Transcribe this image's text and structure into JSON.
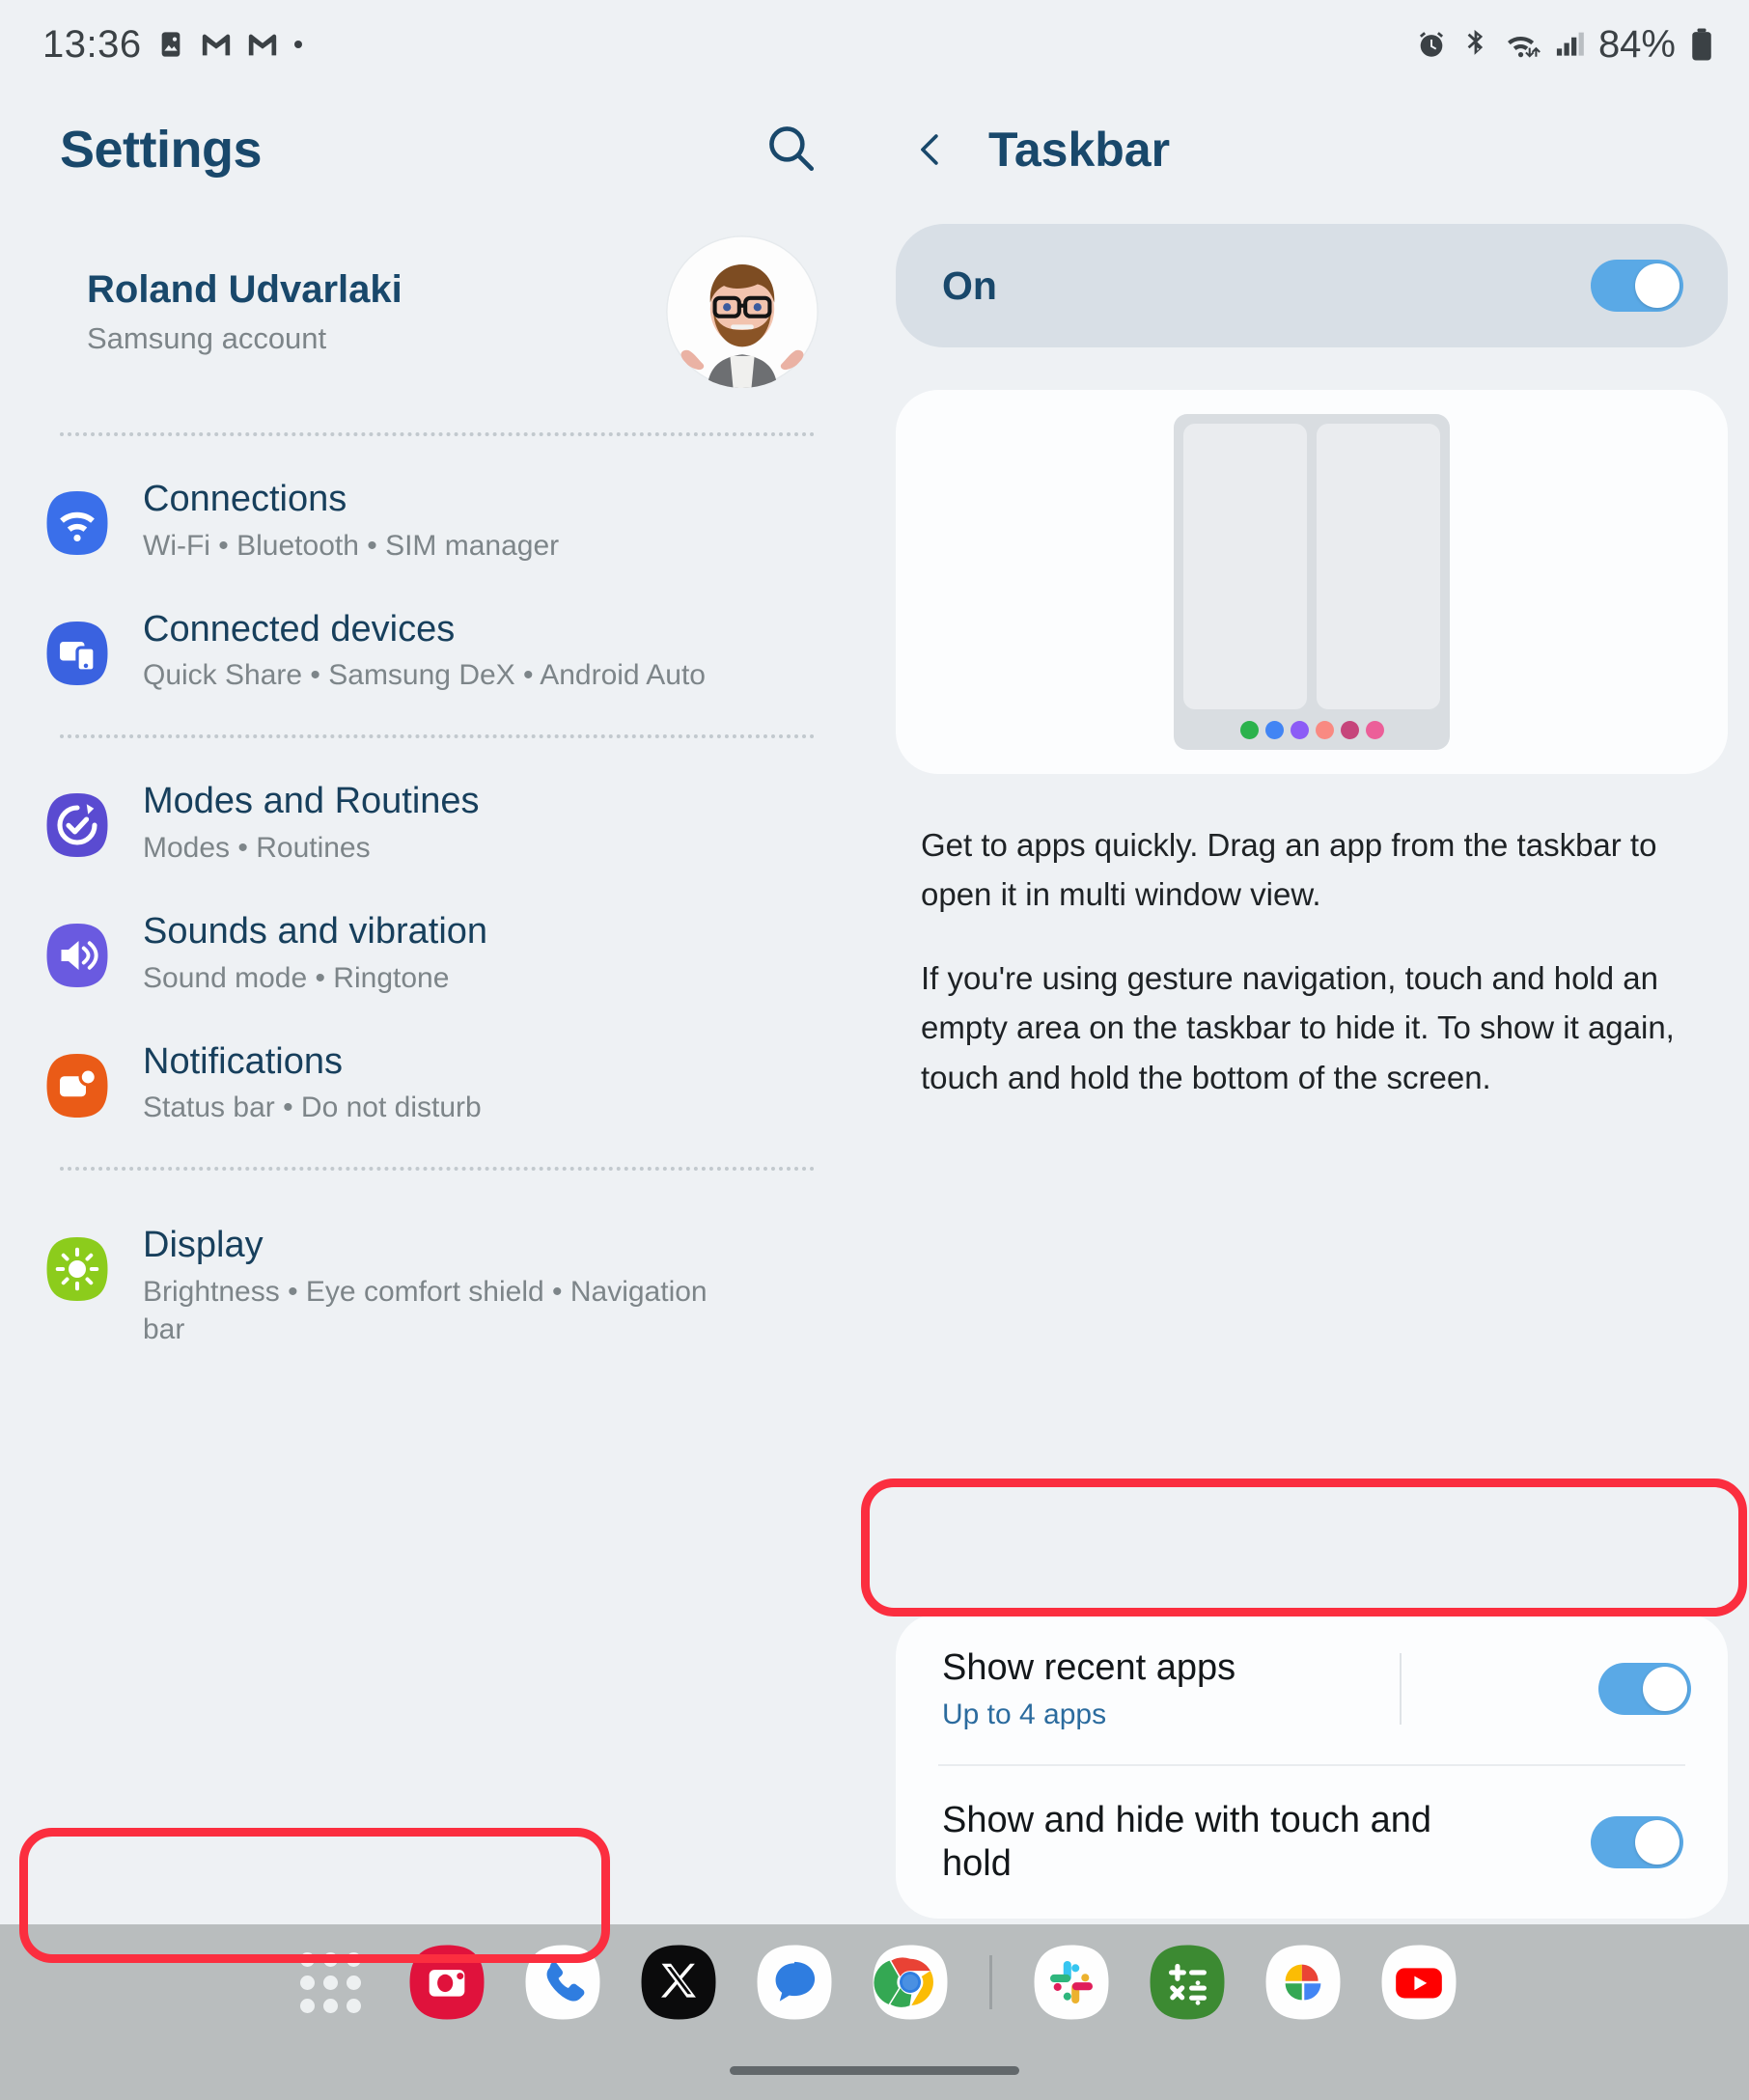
{
  "statusbar": {
    "time": "13:36",
    "left_icons": [
      "image-icon",
      "gmail-icon",
      "gmail-icon",
      "dot-icon"
    ],
    "right_icons": [
      "alarm-icon",
      "bluetooth-icon",
      "wifi-icon",
      "signal-icon"
    ],
    "battery_text": "84%"
  },
  "left_pane": {
    "title": "Settings",
    "search_icon": "search-icon",
    "account": {
      "name": "Roland Udvarlaki",
      "subtitle": "Samsung account",
      "avatar": "ar-emoji-avatar"
    },
    "items": [
      {
        "title": "Connections",
        "subtitle": "Wi-Fi  •  Bluetooth  •  SIM manager",
        "icon": "wifi-icon",
        "color": "#3a6fea"
      },
      {
        "title": "Connected devices",
        "subtitle": "Quick Share  •  Samsung DeX  •  Android Auto",
        "icon": "connected-devices-icon",
        "color": "#3a62e0"
      },
      {
        "title": "Modes and Routines",
        "subtitle": "Modes  •  Routines",
        "icon": "modes-routines-icon",
        "color": "#5a4bd1"
      },
      {
        "title": "Sounds and vibration",
        "subtitle": "Sound mode  •  Ringtone",
        "icon": "speaker-icon",
        "color": "#6a5ae0"
      },
      {
        "title": "Notifications",
        "subtitle": "Status bar  •  Do not disturb",
        "icon": "notifications-icon",
        "color": "#ea5b17"
      },
      {
        "title": "Display",
        "subtitle": "Brightness  •  Eye comfort shield  •  Navigation bar",
        "icon": "brightness-icon",
        "color": "#8ccc1c"
      }
    ]
  },
  "right_pane": {
    "back_icon": "chevron-left-icon",
    "title": "Taskbar",
    "master_toggle": {
      "label": "On",
      "state": "on"
    },
    "illustration": {
      "name": "split-screen-taskbar-illustration",
      "dot_colors": [
        "#2bb24c",
        "#4285f4",
        "#8c5cf6",
        "#f98a82",
        "#c6457b",
        "#ec5f99"
      ]
    },
    "description_paragraphs": [
      "Get to apps quickly. Drag an app from the taskbar to open it in multi window view.",
      "If you're using gesture navigation, touch and hold an empty area on the taskbar to hide it. To show it again, touch and hold the bottom of the screen."
    ],
    "options": [
      {
        "title": "Show recent apps",
        "subtitle": "Up to 4 apps",
        "state": "on",
        "highlighted": true
      },
      {
        "title": "Show and hide with touch and hold",
        "subtitle": "",
        "state": "on",
        "highlighted": false
      }
    ]
  },
  "annotations": {
    "color": "#fb2e3f",
    "targets": [
      "display-settings-row",
      "show-recent-apps-row"
    ]
  },
  "dock": {
    "items": [
      {
        "name": "apps-grid-icon",
        "label": "Apps"
      },
      {
        "name": "camera-icon",
        "label": "Camera"
      },
      {
        "name": "phone-icon",
        "label": "Phone"
      },
      {
        "name": "x-twitter-icon",
        "label": "X"
      },
      {
        "name": "messages-icon",
        "label": "Messages"
      },
      {
        "name": "chrome-icon",
        "label": "Chrome"
      },
      {
        "name": "divider",
        "label": ""
      },
      {
        "name": "slack-icon",
        "label": "Slack"
      },
      {
        "name": "calculator-icon",
        "label": "Calculator"
      },
      {
        "name": "google-photos-icon",
        "label": "Photos"
      },
      {
        "name": "youtube-icon",
        "label": "YouTube"
      }
    ],
    "nav_pill": "gesture-nav-handle"
  }
}
